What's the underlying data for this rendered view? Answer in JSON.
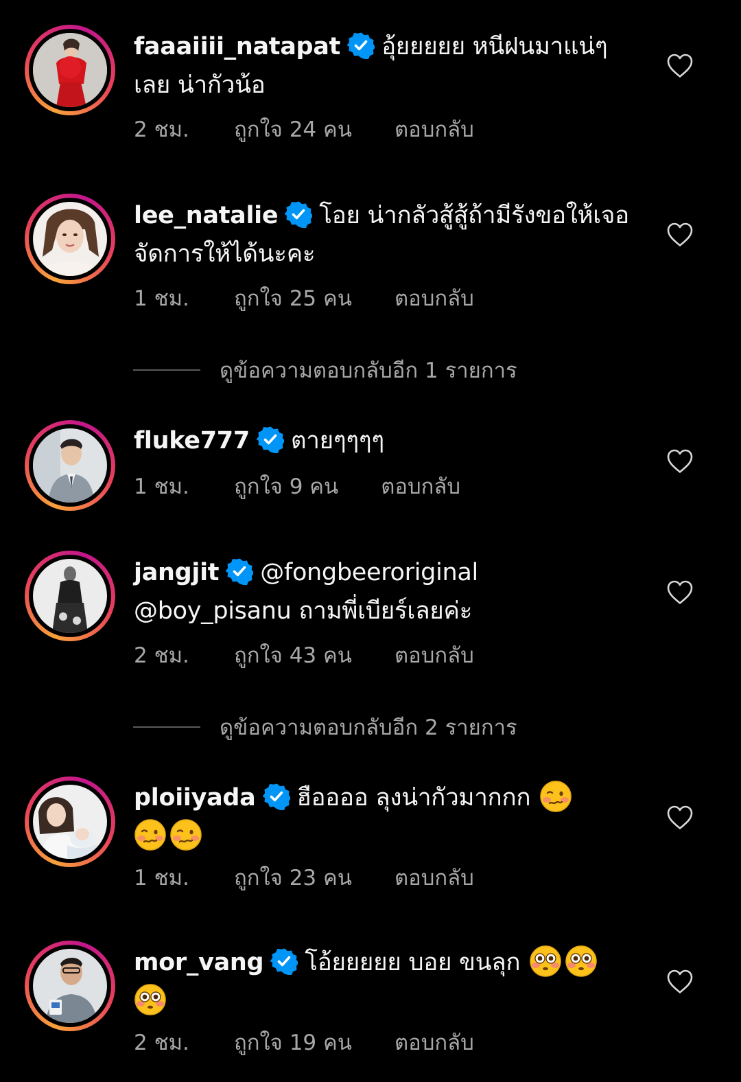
{
  "colors": {
    "background": "#000000",
    "text": "#f5f5f5",
    "secondary": "#a8a8a8",
    "verified": "#0095f6",
    "story_ring": [
      "#f9a23b",
      "#e8405a",
      "#c2168c"
    ]
  },
  "comments": [
    {
      "username": "faaaiiii_natapat",
      "verified": true,
      "text": "อุ้ยยยยย หนีฝนมาแน่ๆเลย น่ากัวน้อ",
      "time": "2 ชม.",
      "likes": "ถูกใจ 24 คน",
      "reply": "ตอบกลับ"
    },
    {
      "username": "lee_natalie",
      "verified": true,
      "text": "โอย น่ากลัวสู้สู้ถ้ามีรังขอให้เจอจัดการให้ได้นะคะ",
      "time": "1 ชม.",
      "likes": "ถูกใจ 25 คน",
      "reply": "ตอบกลับ",
      "view_replies": "ดูข้อความตอบกลับอีก 1 รายการ"
    },
    {
      "username": "fluke777",
      "verified": true,
      "text": "ตายๆๆๆๆ",
      "time": "1 ชม.",
      "likes": "ถูกใจ 9 คน",
      "reply": "ตอบกลับ"
    },
    {
      "username": "jangjit",
      "verified": true,
      "text": "@fongbeeroriginal @boy_pisanu ถามพี่เบียร์เลยค่ะ",
      "time": "2 ชม.",
      "likes": "ถูกใจ 43 คน",
      "reply": "ตอบกลับ",
      "view_replies": "ดูข้อความตอบกลับอีก 2 รายการ"
    },
    {
      "username": "ploiiyada",
      "verified": true,
      "text": "ฮืออออ ลุงน่ากัวมากกก",
      "emoji": "woozy-face",
      "emoji_count": 3,
      "time": "1 ชม.",
      "likes": "ถูกใจ 23 คน",
      "reply": "ตอบกลับ"
    },
    {
      "username": "mor_vang",
      "verified": true,
      "text": "โอ้ยยยยย บอย ขนลุก",
      "emoji": "flushed-face",
      "emoji_count": 3,
      "time": "2 ชม.",
      "likes": "ถูกใจ 19 คน",
      "reply": "ตอบกลับ"
    }
  ]
}
